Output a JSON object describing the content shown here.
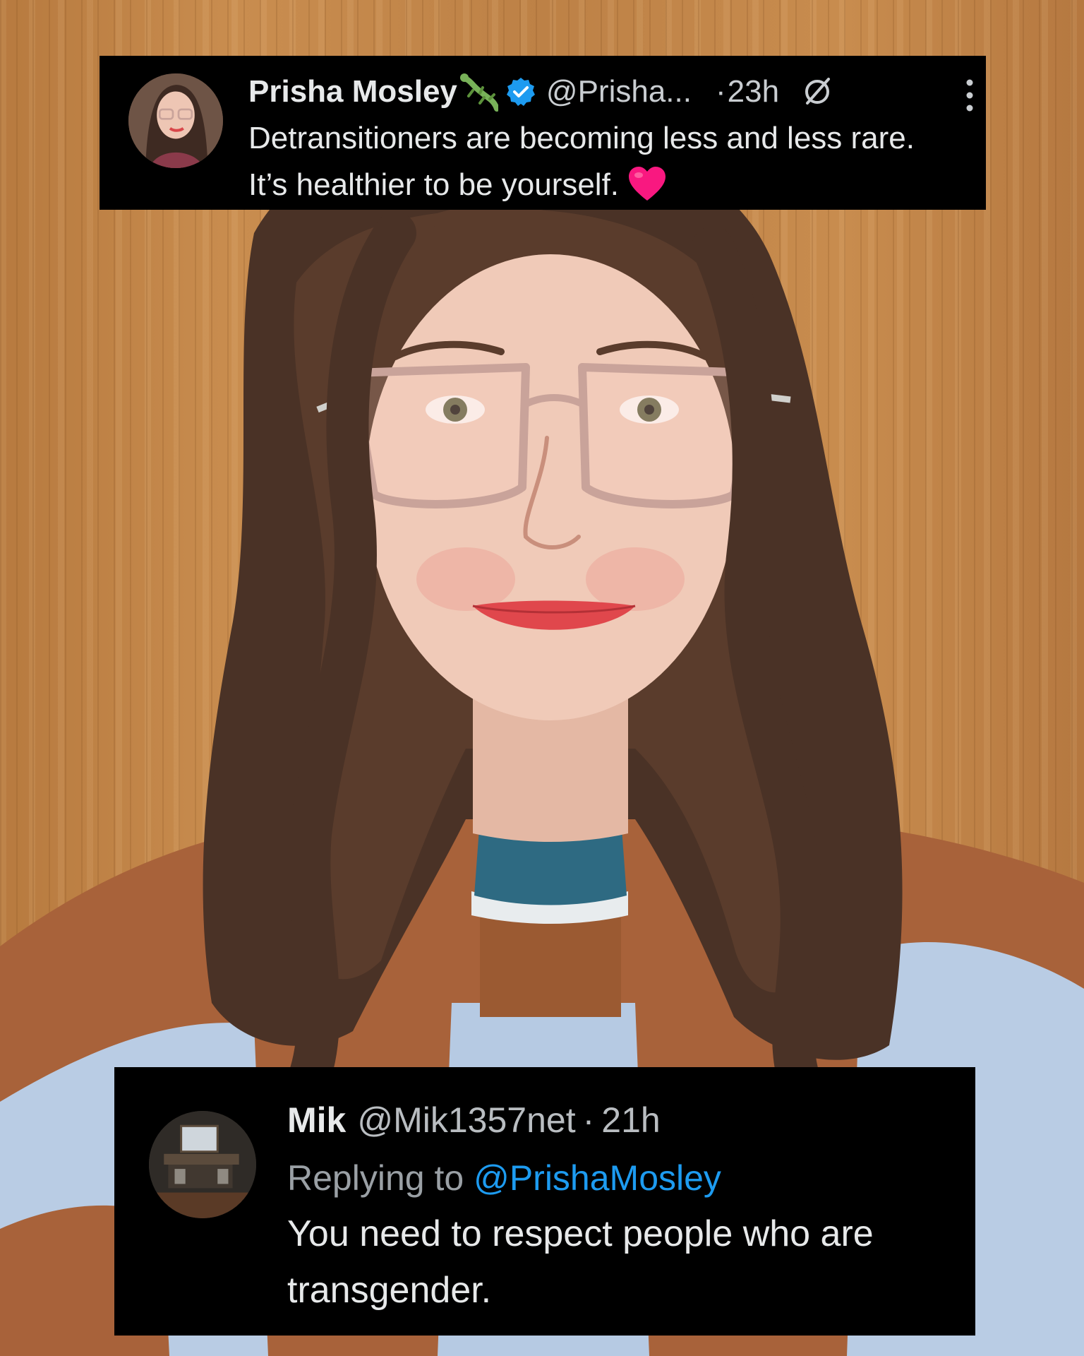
{
  "background": {
    "wall_color": "#c08548",
    "photo_subject_icon": "portrait-photo"
  },
  "original_tweet": {
    "display_name": "Prisha Mosley",
    "name_emoji": "lizard-emoji",
    "verified_icon": "verified-badge-icon",
    "handle": "@Prisha...",
    "separator": "·",
    "timestamp": "23h",
    "status_icon": "mute-icon",
    "menu_icon": "more-vertical-icon",
    "text": "Detransitioners are becoming less and less rare. It’s healthier to be yourself.",
    "trailing_emoji": "heart-emoji",
    "colors": {
      "card": "#000000",
      "text": "#e7e9ea",
      "verified": "#1d9bf0",
      "heart": "#f91880"
    }
  },
  "reply_tweet": {
    "display_name": "Mik",
    "handle": "@Mik1357net",
    "separator": "·",
    "timestamp": "21h",
    "replying_prefix": "Replying to",
    "replying_to": "@PrishaMosley",
    "text": "You need to respect people who are transgender.",
    "colors": {
      "card": "#000000",
      "text": "#e7e9ea",
      "mention": "#1d9bf0",
      "muted": "#9aa0a5"
    }
  }
}
